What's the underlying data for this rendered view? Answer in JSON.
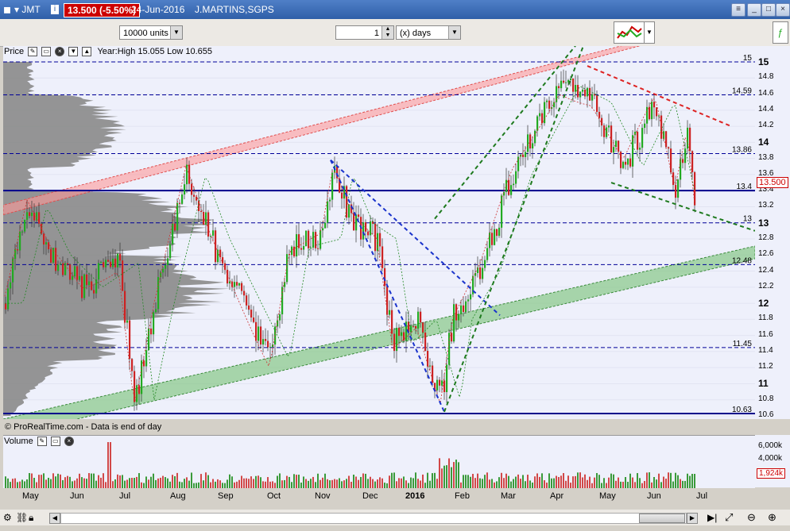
{
  "window": {
    "ticker": "JMT",
    "price_badge": "13.500 (-5.50%)",
    "date": "24-Jun-2016",
    "exchange": "J.MARTINS,SGPS",
    "info_icon": "i"
  },
  "toolbar": {
    "units": "10000 units",
    "period_value": "1",
    "period_unit": "(x) days"
  },
  "pane": {
    "label": "Price",
    "year_info": "Year:High 15.055 Low 10.655",
    "footer": "© ProRealTime.com - Data is end of day",
    "volume_label": "Volume"
  },
  "last_price": "13.500",
  "axis": {
    "price_ticks": [
      "15",
      "14.8",
      "14.6",
      "14.4",
      "14.2",
      "14",
      "13.8",
      "13.6",
      "13.4",
      "13.2",
      "13",
      "12.8",
      "12.6",
      "12.4",
      "12.2",
      "12",
      "11.8",
      "11.6",
      "11.4",
      "11.2",
      "11",
      "10.8",
      "10.6"
    ],
    "bold_ticks": [
      "15",
      "14",
      "13",
      "12",
      "11"
    ],
    "volume_ticks": [
      "6,000k",
      "4,000k"
    ],
    "volume_last": "1,924k",
    "months": [
      "May",
      "Jun",
      "Jul",
      "Aug",
      "Sep",
      "Oct",
      "Nov",
      "Dec",
      "2016",
      "Feb",
      "Mar",
      "Apr",
      "May",
      "Jun",
      "Jul"
    ]
  },
  "levels": [
    "15",
    "14.59",
    "13.86",
    "13.4",
    "13",
    "12.48",
    "11.45",
    "10.63"
  ],
  "colors": {
    "accent": "#2f5fa8",
    "badge": "#cc0000",
    "up": "#22aa22",
    "down": "#cc2222",
    "channel_top": "#ff9999",
    "channel_bottom": "#88c888",
    "level_line": "#000099"
  }
}
